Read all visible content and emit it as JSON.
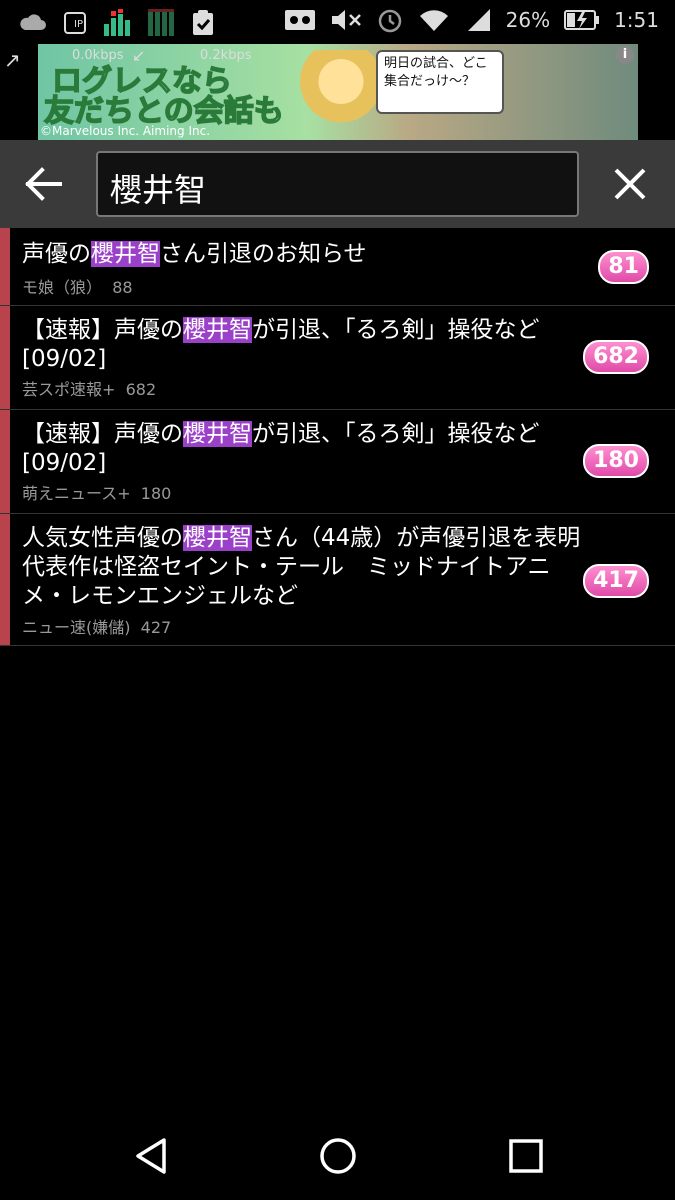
{
  "status_bar": {
    "battery_percent": "26%",
    "time": "1:51"
  },
  "ad": {
    "rate_down": "0.0kbps",
    "rate_up": "0.2kbps",
    "headline_1": "ログレスなら",
    "headline_2": "友だちとの会話も",
    "bubble_text": "明日の試合、どこ集合だっけ～？",
    "copyright": "©Marvelous Inc. Aiming Inc.",
    "info": "i"
  },
  "search": {
    "query": "櫻井智"
  },
  "results": [
    {
      "title_before": "声優の",
      "highlight": "櫻井智",
      "title_after": "さん引退のお知らせ",
      "source": "モ娘（狼）",
      "count": "88",
      "badge": "81"
    },
    {
      "title_before": "【速報】声優の",
      "highlight": "櫻井智",
      "title_after": "が引退、「るろ剣」操役など[09/02]",
      "source": "芸スポ速報+",
      "count": "682",
      "badge": "682"
    },
    {
      "title_before": "【速報】声優の",
      "highlight": "櫻井智",
      "title_after": "が引退、「るろ剣」操役など[09/02]",
      "source": "萌えニュース+",
      "count": "180",
      "badge": "180"
    },
    {
      "title_before": "人気女性声優の",
      "highlight": "櫻井智",
      "title_after": "さん（44歳）が声優引退を表明　代表作は怪盗セイント・テール　ミッドナイトアニメ・レモンエンジェルなど",
      "source": "ニュー速(嫌儲)",
      "count": "427",
      "badge": "417"
    }
  ],
  "colors": {
    "accent": "#b8434d",
    "highlight": "#9b40c8",
    "badge": "#e04aa8"
  }
}
